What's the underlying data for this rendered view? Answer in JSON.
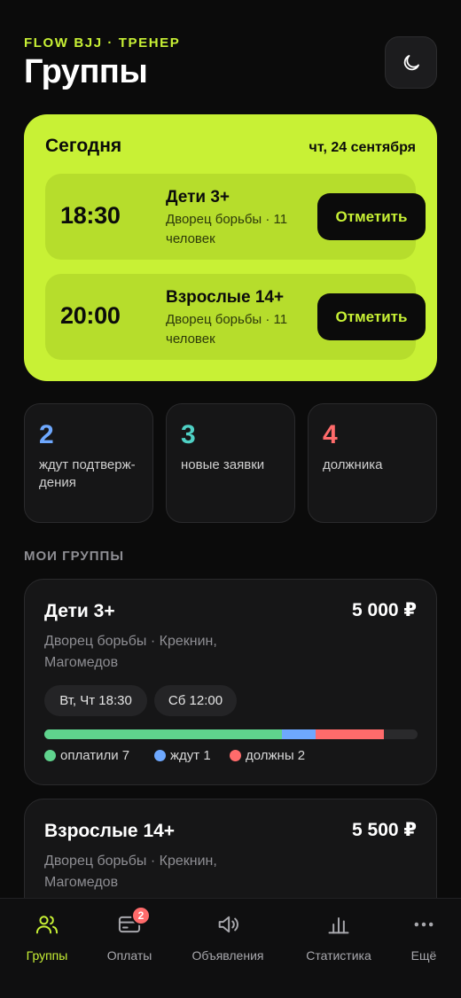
{
  "header": {
    "brand": "FLOW BJJ · ТРЕНЕР",
    "title": "Группы",
    "theme_icon": "moon-icon"
  },
  "today": {
    "title": "Сегодня",
    "date": "чт, 24 сентября",
    "sessions": [
      {
        "time": "18:30",
        "name": "Дети 3+",
        "meta": "Дворец борьбы · 11 человек",
        "button": "Отметить"
      },
      {
        "time": "20:00",
        "name": "Взрослые 14+",
        "meta": "Дворец борьбы · 11 человек",
        "button": "Отметить"
      }
    ]
  },
  "stats": [
    {
      "value": "2",
      "label": "ждут подтверж-дения",
      "color": "#6ea8fe"
    },
    {
      "value": "3",
      "label": "новые заявки",
      "color": "#4fd1c5"
    },
    {
      "value": "4",
      "label": "должника",
      "color": "#ff6b6b"
    }
  ],
  "groups_section": {
    "label": "МОИ ГРУППЫ"
  },
  "groups": [
    {
      "name": "Дети 3+",
      "price": "5 000 ₽",
      "meta": "Дворец борьбы · Крекнин, Магомедов",
      "schedule": [
        "Вт, Чт 18:30",
        "Сб 12:00"
      ],
      "payments": {
        "paid": 7,
        "waiting": 1,
        "owe": 2
      },
      "legend": {
        "paid": "оплатили 7",
        "waiting": "ждут 1",
        "owe": "должны 2"
      }
    },
    {
      "name": "Взрослые 14+",
      "price": "5 500 ₽",
      "meta": "Дворец борьбы · Крекнин, Магомедов"
    }
  ],
  "colors": {
    "accent": "#c8f135",
    "paid": "#5fd38d",
    "waiting": "#6ea8fe",
    "owe": "#ff6b6b"
  },
  "nav": {
    "items": [
      {
        "label": "Группы",
        "icon": "users-icon",
        "active": true
      },
      {
        "label": "Оплаты",
        "icon": "card-icon",
        "badge": "2"
      },
      {
        "label": "Объявления",
        "icon": "megaphone-icon"
      },
      {
        "label": "Статистика",
        "icon": "chart-icon"
      },
      {
        "label": "Ещё",
        "icon": "more-icon"
      }
    ]
  }
}
